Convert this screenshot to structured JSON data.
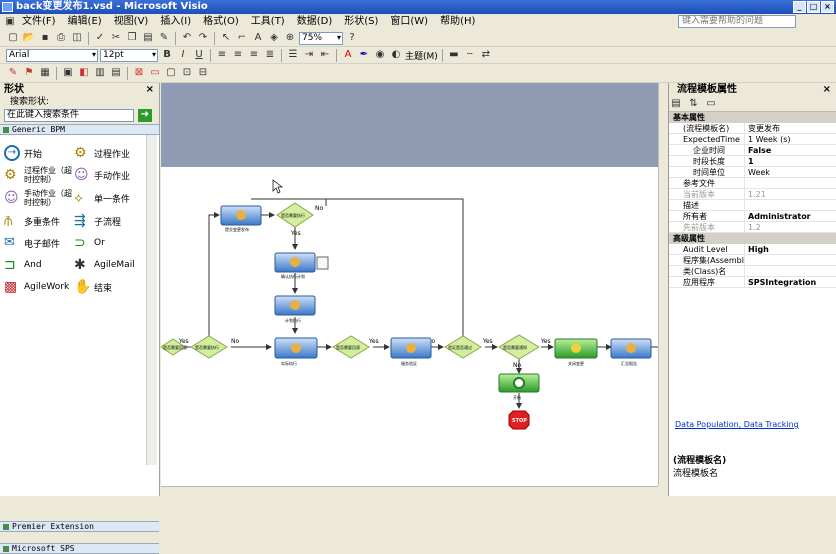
{
  "window": {
    "title": "back变更发布1.vsd - Microsoft Visio"
  },
  "menu": [
    "文件(F)",
    "编辑(E)",
    "视图(V)",
    "插入(I)",
    "格式(O)",
    "工具(T)",
    "数据(D)",
    "形状(S)",
    "窗口(W)",
    "帮助(H)"
  ],
  "help_placeholder": "键入需要帮助的问题",
  "toolbar": {
    "zoom": "75%",
    "font": "Arial",
    "size": "12pt",
    "theme": "主题(M)"
  },
  "shapes_panel": {
    "title": "形状",
    "search_label": "搜索形状:",
    "search_placeholder": "在此键入搜索条件",
    "stencil": "Generic BPM",
    "items": [
      "开始",
      "过程作业",
      "过程作业（超时控制）",
      "手动作业",
      "手动作业（超时控制）",
      "单一条件",
      "多重条件",
      "子流程",
      "电子邮件",
      "Or",
      "And",
      "AgileMail",
      "AgileWork",
      "结束"
    ],
    "bottom_stencils": [
      "Premier Extension",
      "Microsoft SPS"
    ]
  },
  "properties": {
    "title": "流程模板属性",
    "cat_basic": "基本属性",
    "rows_basic": [
      {
        "name": "(流程模板名)",
        "value": "变更发布"
      },
      {
        "name": "ExpectedTime",
        "value": "1 Week (s)"
      },
      {
        "name": "企业时间",
        "value": "False"
      },
      {
        "name": "时段长度",
        "value": "1"
      },
      {
        "name": "时间单位",
        "value": "Week"
      },
      {
        "name": "参考文件",
        "value": ""
      },
      {
        "name": "当前版本",
        "value": "1.21"
      },
      {
        "name": "描述",
        "value": ""
      },
      {
        "name": "所有者",
        "value": "Administrator"
      },
      {
        "name": "先前版本",
        "value": "1.2"
      }
    ],
    "cat_adv": "高级属性",
    "rows_adv": [
      {
        "name": "Audit Level",
        "value": "High"
      },
      {
        "name": "程序集(Assembly)",
        "value": ""
      },
      {
        "name": "类(Class)名",
        "value": ""
      },
      {
        "name": "应用程序",
        "value": "SPSIntegration"
      }
    ],
    "links": "Data Population, Data Tracking",
    "desc_title": "(流程模板名)",
    "desc_text": "流程模板名"
  },
  "diagram": {
    "yes": "Yes",
    "no": "No",
    "stop": "STOP",
    "nodes": [
      "提交变更发布",
      "是否需要执行",
      "确认执行计划",
      "确认执行",
      "计划执行",
      "实际执行",
      "是否需要回滚",
      "服务验证",
      "验证是否通过",
      "是否需要通知",
      "关闭变更",
      "汇总报告",
      "开始",
      "结束"
    ]
  }
}
